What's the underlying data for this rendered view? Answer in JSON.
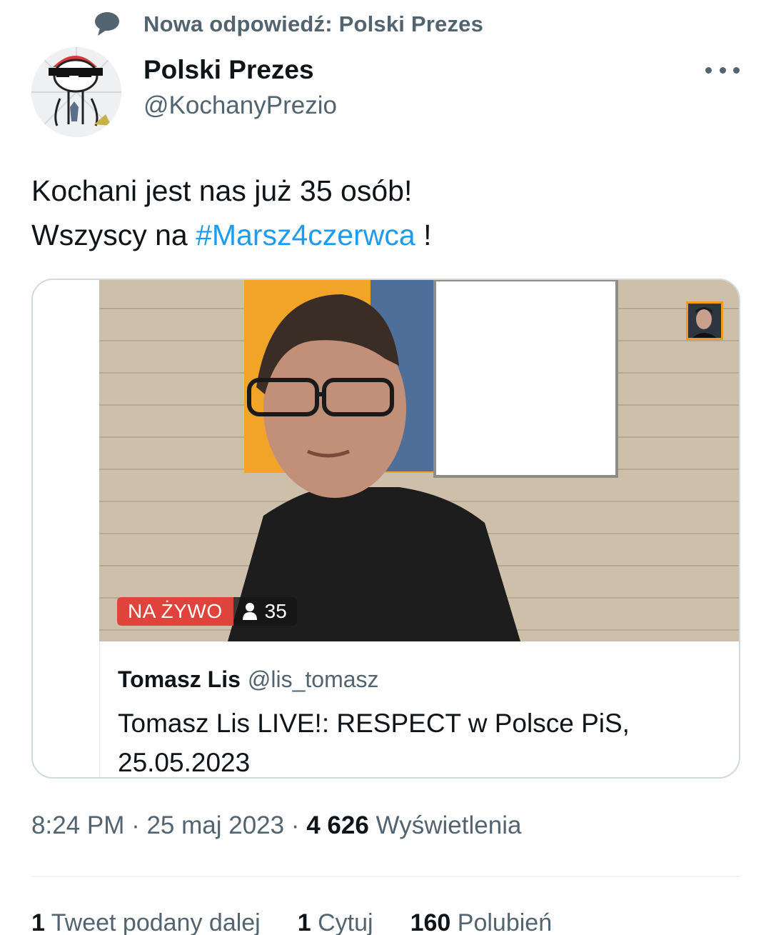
{
  "reply_context": {
    "label": "Nowa odpowiedź: Polski Prezes",
    "icon": "speech-bubble-icon"
  },
  "author": {
    "name": "Polski Prezes",
    "handle": "@KochanyPrezio",
    "avatar_icon": "cartoon-avatar-with-sunglasses"
  },
  "more_icon": "more-dots-icon",
  "tweet": {
    "line1": "Kochani jest nas już 35 osób!",
    "line2_prefix": "Wszyscy na ",
    "hashtag": "#Marsz4czerwca",
    "line2_suffix": " !"
  },
  "card": {
    "live_label": "NA ŻYWO",
    "viewer_count": "35",
    "name": "Tomasz Lis",
    "handle": "@lis_tomasz",
    "title_line1": "Tomasz Lis LIVE!: RESPECT w Polsce PiS,",
    "title_line2": "25.05.2023"
  },
  "timestamp": {
    "time_date": "8:24 PM · 25 maj 2023 · ",
    "views_count": "4 626",
    "views_label": " Wyświetlenia"
  },
  "stats": {
    "retweets_count": "1",
    "retweets_label": " Tweet podany dalej",
    "quotes_count": "1",
    "quotes_label": " Cytuj",
    "likes_count": "160",
    "likes_label": " Polubień"
  },
  "colors": {
    "link": "#1d9bf0",
    "secondary_text": "#536471",
    "live_red": "#e0433b"
  }
}
